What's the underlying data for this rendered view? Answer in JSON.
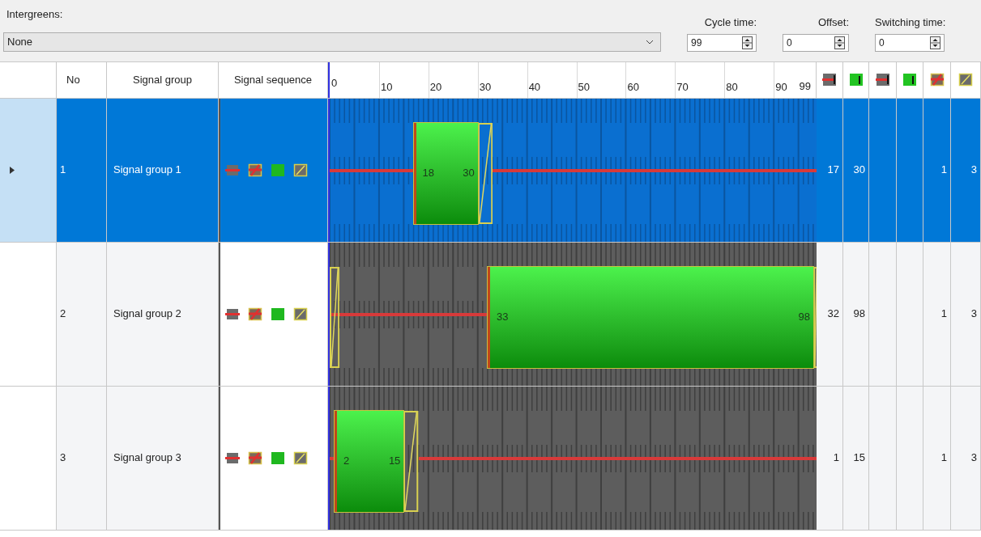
{
  "intergreens": {
    "label": "Intergreens:",
    "value": "None"
  },
  "cycle_time": {
    "label": "Cycle time:",
    "value": "99"
  },
  "offset": {
    "label": "Offset:",
    "value": "0"
  },
  "switching_time": {
    "label": "Switching time:",
    "value": "0"
  },
  "table": {
    "columns": [
      "No",
      "Signal group",
      "Signal sequence"
    ],
    "time_ticks": [
      "0",
      "10",
      "20",
      "30",
      "40",
      "50",
      "60",
      "70",
      "80",
      "90",
      "99"
    ],
    "icon_columns": [
      {
        "kind": "red-end"
      },
      {
        "kind": "green-end"
      },
      {
        "kind": "red-end"
      },
      {
        "kind": "green-end"
      },
      {
        "kind": "red-amber"
      },
      {
        "kind": "amber"
      }
    ],
    "rows": [
      {
        "selected": true,
        "no": "1",
        "signal_group": "Signal group 1",
        "sequence": [
          {
            "kind": "red"
          },
          {
            "kind": "red-amber"
          },
          {
            "kind": "green"
          },
          {
            "kind": "amber"
          }
        ],
        "green_start_label": "18",
        "green_end_label": "30",
        "column_1": "17",
        "column_2": "30",
        "column_5": "1",
        "column_6": "3"
      },
      {
        "selected": false,
        "no": "2",
        "signal_group": "Signal group 2",
        "sequence": [
          {
            "kind": "red"
          },
          {
            "kind": "red-amber"
          },
          {
            "kind": "green"
          },
          {
            "kind": "amber"
          }
        ],
        "green_start_label": "33",
        "green_end_label": "98",
        "column_1": "32",
        "column_2": "98",
        "column_5": "1",
        "column_6": "3"
      },
      {
        "selected": false,
        "no": "3",
        "signal_group": "Signal group 3",
        "sequence": [
          {
            "kind": "red"
          },
          {
            "kind": "red-amber"
          },
          {
            "kind": "green"
          },
          {
            "kind": "amber"
          }
        ],
        "green_start_label": "2",
        "green_end_label": "15",
        "column_1": "1",
        "column_2": "15",
        "column_5": "1",
        "column_6": "3"
      }
    ]
  }
}
